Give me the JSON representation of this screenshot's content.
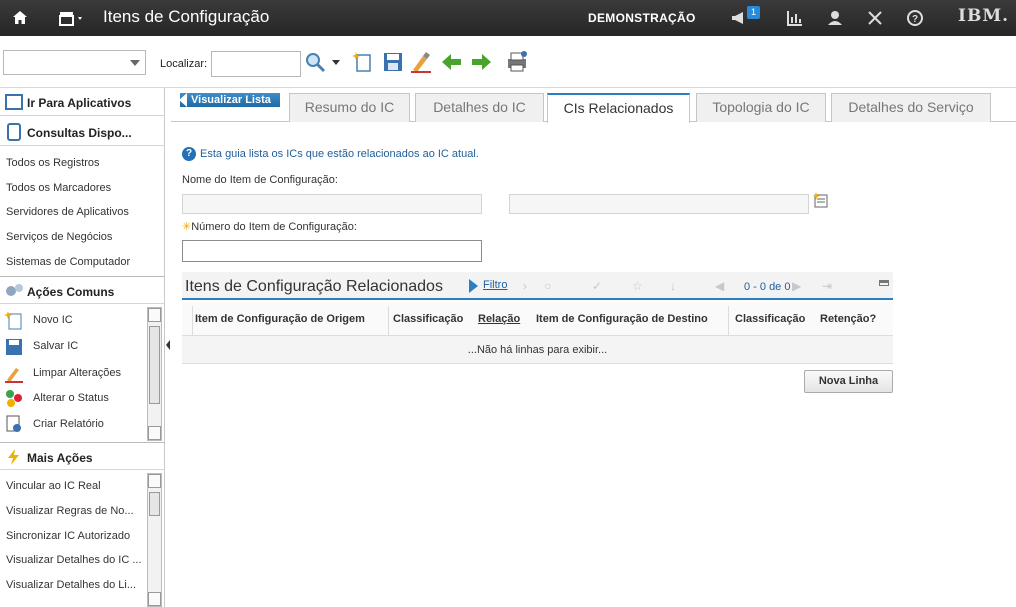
{
  "header": {
    "title": "Itens de Configuração",
    "environment": "DEMONSTRAÇÃO",
    "notification_count": "1",
    "logo": "IBM."
  },
  "toolbar": {
    "find_label": "Localizar:",
    "find_value": "",
    "select_value": ""
  },
  "sidebar": {
    "goto_apps": "Ir Para Aplicativos",
    "queries_title": "Consultas Dispo...",
    "queries": [
      "Todos os Registros",
      "Todos os Marcadores",
      "Servidores de Aplicativos",
      "Serviços de Negócios",
      "Sistemas de Computador"
    ],
    "common_title": "Ações Comuns",
    "common": [
      "Novo IC",
      "Salvar IC",
      "Limpar Alterações",
      "Alterar o Status",
      "Criar Relatório"
    ],
    "more_title": "Mais Ações",
    "more": [
      "Vincular ao IC Real",
      "Visualizar Regras de No...",
      "Sincronizar IC Autorizado",
      "Visualizar Detalhes do IC ...",
      "Visualizar Detalhes do Li..."
    ]
  },
  "tabs": {
    "list_button": "Visualizar Lista",
    "items": [
      "Resumo do IC",
      "Detalhes do IC",
      "CIs Relacionados",
      "Topologia do IC",
      "Detalhes do Serviço"
    ],
    "active_index": 2
  },
  "content": {
    "info": "Esta guia lista os ICs que estão relacionados ao IC atual.",
    "ci_name_label": "Nome do Item de Configuração:",
    "ci_name_value": "",
    "ci_desc_value": "",
    "ci_number_label": "Número do Item de Configuração:",
    "ci_number_value": ""
  },
  "table": {
    "title": "Itens de Configuração Relacionados",
    "filter": "Filtro",
    "pagination": "0 - 0 de 0",
    "columns": [
      "Item de Configuração de Origem",
      "Classificação",
      "Relação",
      "Item de Configuração de Destino",
      "Classificação",
      "Retenção?"
    ],
    "empty": "...Não há linhas para exibir...",
    "new_row": "Nova Linha"
  },
  "colors": {
    "header_bg": "#2f2f2f",
    "accent": "#2b7fc1",
    "link": "#1f5f9c"
  }
}
